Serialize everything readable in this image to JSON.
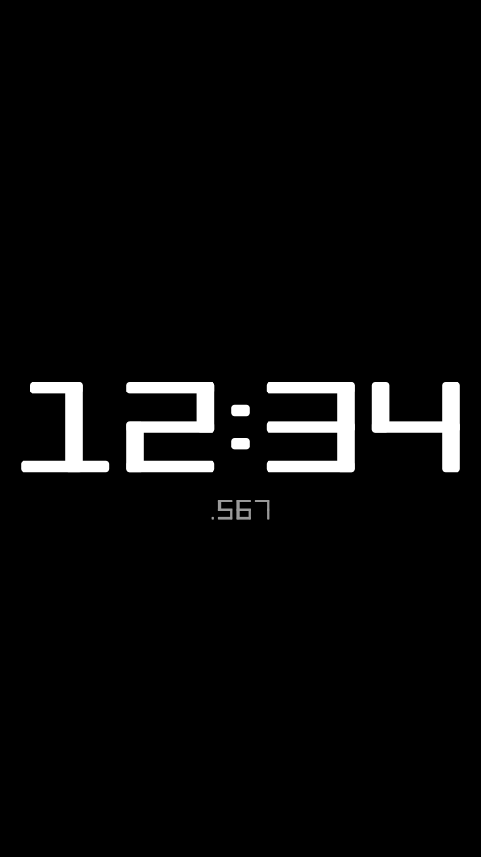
{
  "clock": {
    "time": "12:34",
    "fraction": ".567",
    "digit_color": "#ffffff",
    "fraction_color": "#9a9a9a",
    "background_color": "#000000"
  }
}
